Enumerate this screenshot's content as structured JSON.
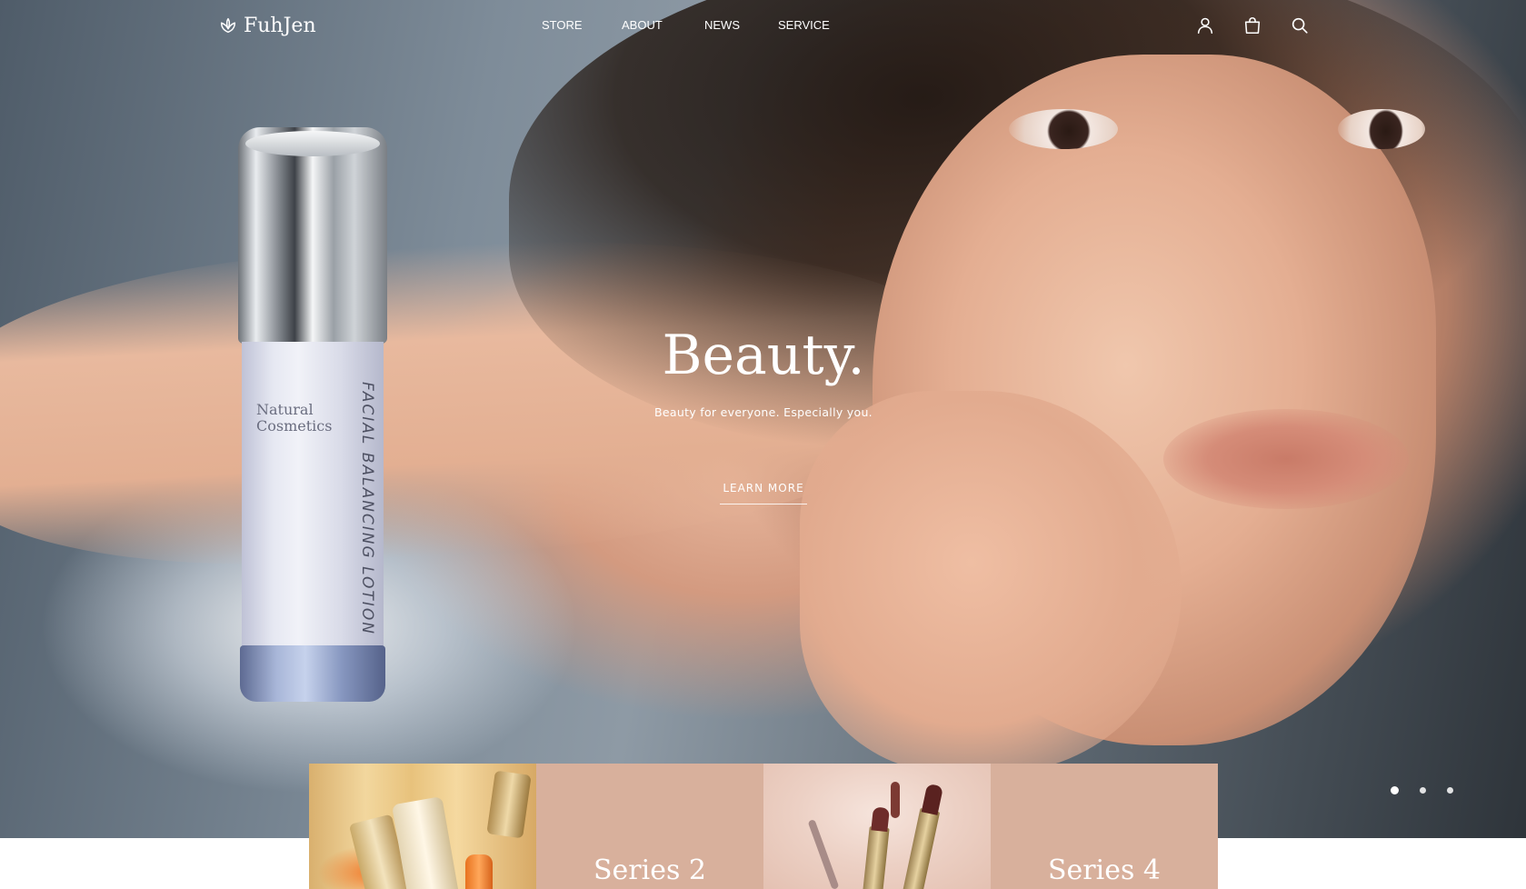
{
  "brand": {
    "name": "FuhJen",
    "logo_icon": "lotus-icon"
  },
  "nav": {
    "items": [
      {
        "label": "STORE"
      },
      {
        "label": "ABOUT"
      },
      {
        "label": "NEWS"
      },
      {
        "label": "SERVICE"
      }
    ]
  },
  "header_icons": {
    "user": "user-icon",
    "cart": "shopping-bag-icon",
    "search": "search-icon"
  },
  "hero": {
    "title": "Beauty.",
    "subtitle": "Beauty for everyone. Especially you.",
    "cta_label": "LEARN MORE",
    "product_label_small": "Natural Cosmetics",
    "product_label_vertical": "FACIAL BALANCING LOTION",
    "slider": {
      "total": 3,
      "active_index": 0
    }
  },
  "series": [
    {
      "label": ""
    },
    {
      "label": "Series 2"
    },
    {
      "label": ""
    },
    {
      "label": "Series 4"
    }
  ],
  "colors": {
    "series_panel": "#d8b09c",
    "text_on_hero": "#ffffff",
    "page_background": "#ffffff"
  }
}
